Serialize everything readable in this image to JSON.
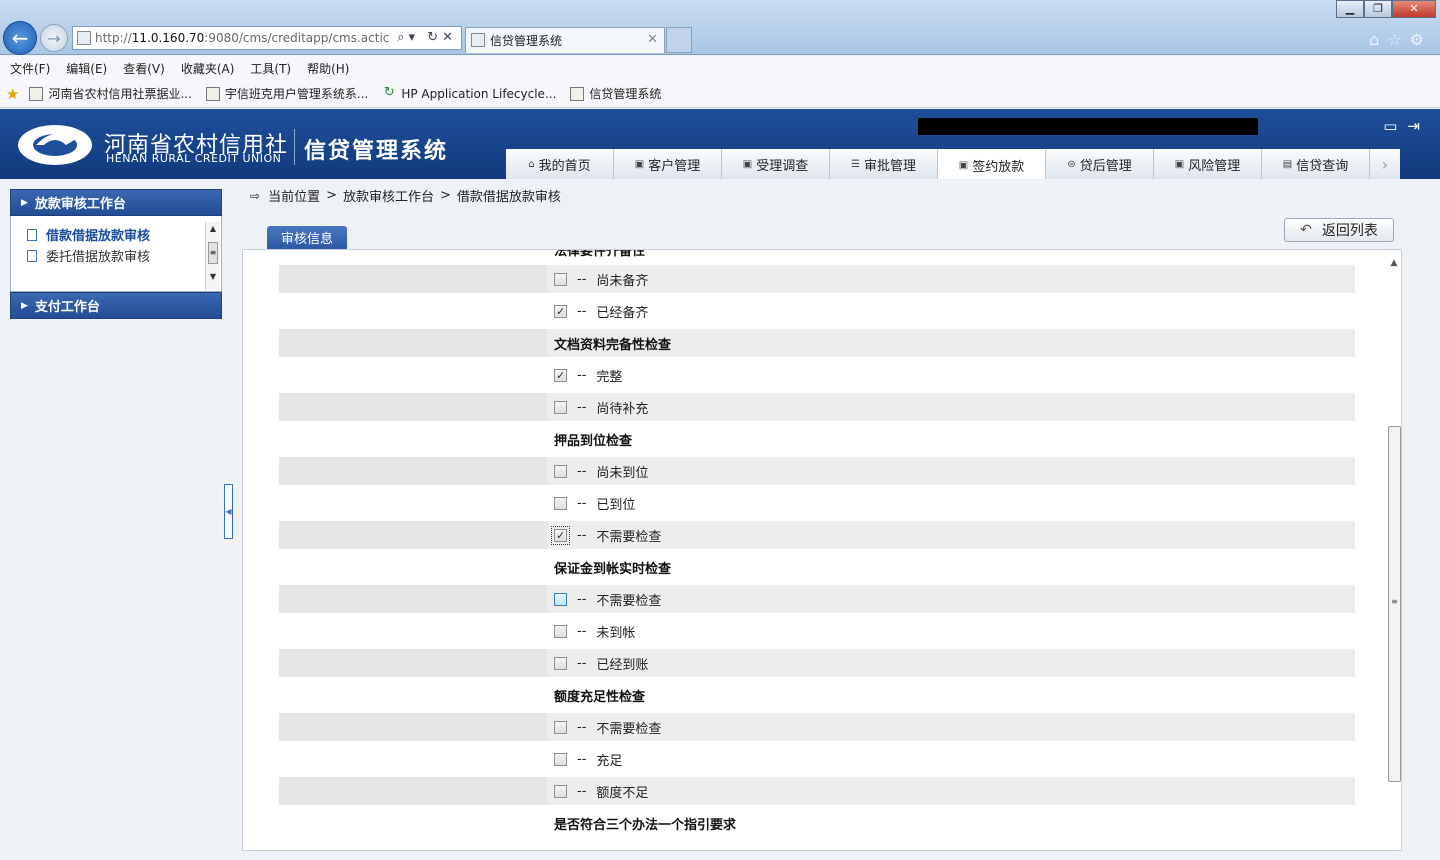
{
  "browser": {
    "url_prefix": "http://",
    "url_host": "11.0.160.70",
    "url_rest": ":9080/cms/creditapp/cms.actic",
    "tab_title": "信贷管理系统",
    "menu": [
      "文件(F)",
      "编辑(E)",
      "查看(V)",
      "收藏夹(A)",
      "工具(T)",
      "帮助(H)"
    ],
    "favorites": [
      "河南省农村信用社票据业...",
      "宇信班克用户管理系统系...",
      "HP Application Lifecycle...",
      "信贷管理系统"
    ]
  },
  "header": {
    "brand_cn": "河南省农村信用社",
    "brand_en": "HENAN RURAL CREDIT UNION",
    "system_name": "信贷管理系统",
    "nav": [
      {
        "label": "我的首页",
        "icon": "home-icon"
      },
      {
        "label": "客户管理",
        "icon": "customer-icon"
      },
      {
        "label": "受理调查",
        "icon": "survey-icon"
      },
      {
        "label": "审批管理",
        "icon": "approval-icon"
      },
      {
        "label": "签约放款",
        "icon": "contract-icon"
      },
      {
        "label": "贷后管理",
        "icon": "postloan-icon"
      },
      {
        "label": "风险管理",
        "icon": "risk-icon"
      },
      {
        "label": "信贷查询",
        "icon": "query-icon"
      }
    ],
    "active_nav": "签约放款"
  },
  "sidebar": {
    "section1": "放款审核工作台",
    "items": [
      "借款借据放款审核",
      "委托借据放款审核"
    ],
    "section2": "支付工作台"
  },
  "breadcrumb": {
    "label": "当前位置",
    "items": [
      "放款审核工作台",
      "借款借据放款审核"
    ]
  },
  "main": {
    "tab_label": "审核信息",
    "back_button": "返回列表",
    "dash": "--",
    "group_legal": "法律要件齐备性",
    "legal_opt1": "尚未备齐",
    "legal_opt2": "已经备齐",
    "group_doc": "文档资料完备性检查",
    "doc_opt1": "完整",
    "doc_opt2": "尚待补充",
    "group_collateral": "押品到位检查",
    "coll_opt1": "尚未到位",
    "coll_opt2": "已到位",
    "coll_opt3": "不需要检查",
    "group_deposit": "保证金到帐实时检查",
    "dep_opt1": "不需要检查",
    "dep_opt2": "未到帐",
    "dep_opt3": "已经到账",
    "group_limit": "额度充足性检查",
    "lim_opt1": "不需要检查",
    "lim_opt2": "充足",
    "lim_opt3": "额度不足",
    "group_rules": "是否符合三个办法一个指引要求"
  }
}
